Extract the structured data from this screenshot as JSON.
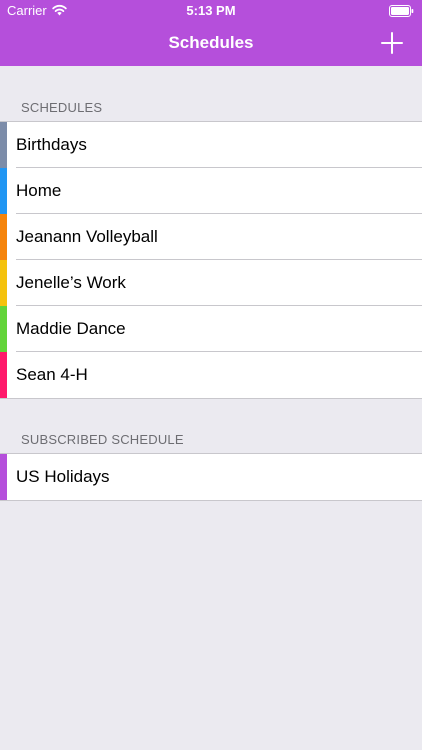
{
  "status_bar": {
    "carrier": "Carrier",
    "time": "5:13 PM",
    "wifi_icon": "wifi-icon",
    "battery_icon": "battery-icon"
  },
  "nav": {
    "title": "Schedules",
    "add_icon": "plus-icon",
    "background_color": "#B54FDB"
  },
  "sections": {
    "schedules": {
      "header": "SCHEDULES",
      "items": [
        {
          "label": "Birthdays",
          "color": "#7C8CA9"
        },
        {
          "label": "Home",
          "color": "#2196F3"
        },
        {
          "label": "Jeanann Volleyball",
          "color": "#F5840C"
        },
        {
          "label": "Jenelle’s Work",
          "color": "#F4C20D"
        },
        {
          "label": "Maddie Dance",
          "color": "#62D43A"
        },
        {
          "label": "Sean 4-H",
          "color": "#FF1A6B"
        }
      ]
    },
    "subscribed": {
      "header": "SUBSCRIBED SCHEDULE",
      "items": [
        {
          "label": "US Holidays",
          "color": "#B54FDB"
        }
      ]
    }
  }
}
